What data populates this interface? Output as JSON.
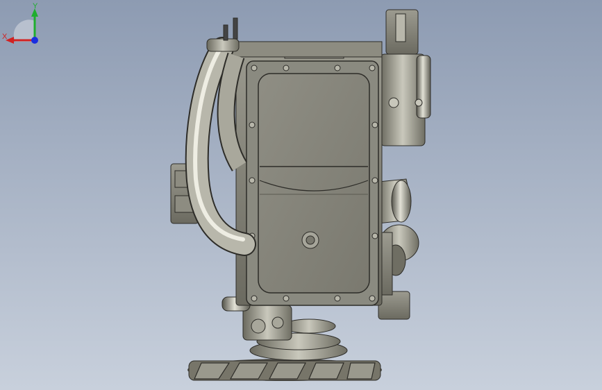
{
  "viewport": {
    "background_top": "#8d9bb2",
    "background_bottom": "#c8d0dc",
    "model_description_icon": "engine-block-model"
  },
  "triad": {
    "x_label": "X",
    "y_label": "Y",
    "x_color": "#d12222",
    "y_color": "#1fae2e",
    "z_color": "#1a2ee0"
  }
}
